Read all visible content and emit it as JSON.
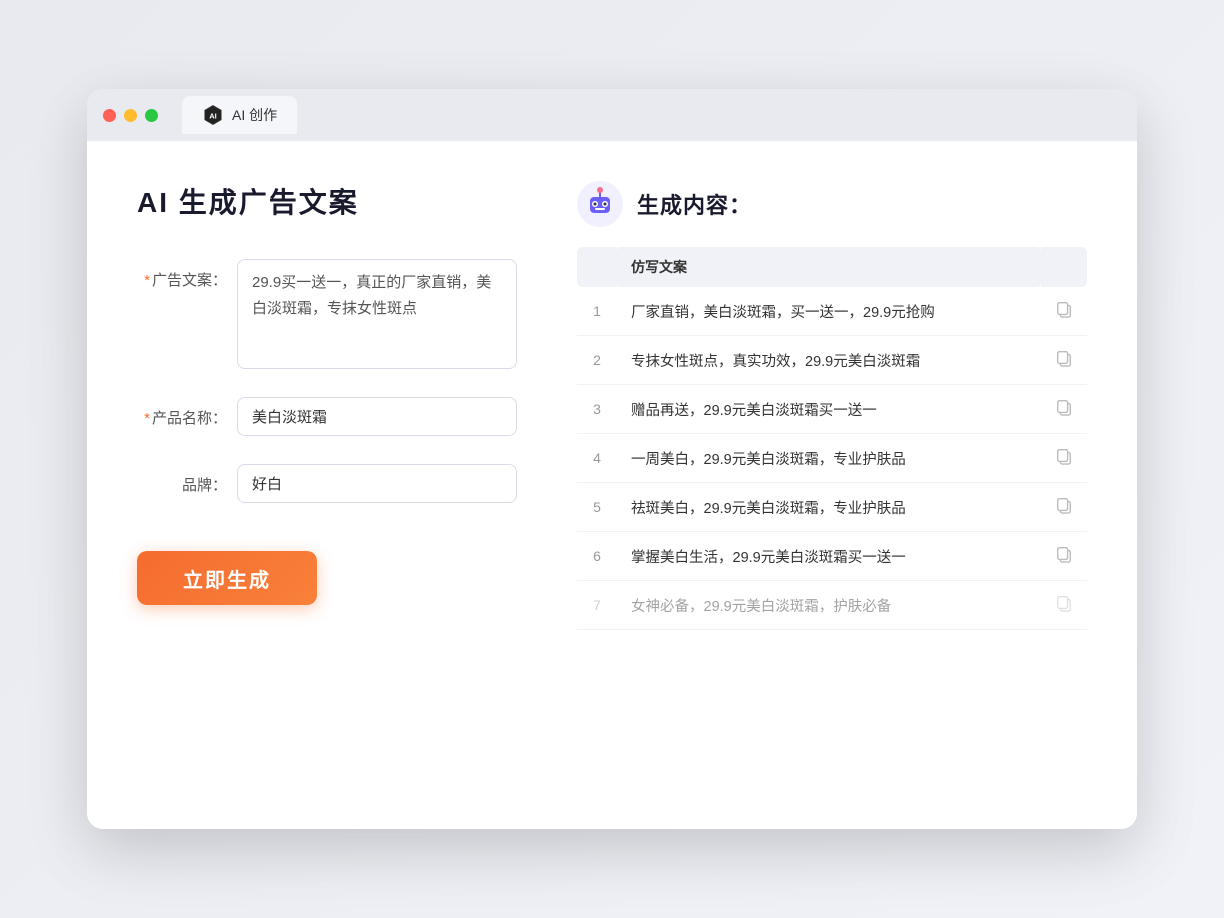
{
  "browser": {
    "tab_label": "AI 创作",
    "traffic_lights": [
      "red",
      "yellow",
      "green"
    ]
  },
  "left_panel": {
    "title": "AI 生成广告文案",
    "fields": [
      {
        "id": "ad_copy",
        "label": "广告文案：",
        "required": true,
        "type": "textarea",
        "value": "29.9买一送一，真正的厂家直销，美白淡斑霜，专抹女性斑点"
      },
      {
        "id": "product_name",
        "label": "产品名称：",
        "required": true,
        "type": "input",
        "value": "美白淡斑霜"
      },
      {
        "id": "brand",
        "label": "品牌：",
        "required": false,
        "type": "input",
        "value": "好白"
      }
    ],
    "submit_label": "立即生成"
  },
  "right_panel": {
    "title": "生成内容：",
    "col_header": "仿写文案",
    "results": [
      {
        "num": 1,
        "text": "厂家直销，美白淡斑霜，买一送一，29.9元抢购",
        "faded": false
      },
      {
        "num": 2,
        "text": "专抹女性斑点，真实功效，29.9元美白淡斑霜",
        "faded": false
      },
      {
        "num": 3,
        "text": "赠品再送，29.9元美白淡斑霜买一送一",
        "faded": false
      },
      {
        "num": 4,
        "text": "一周美白，29.9元美白淡斑霜，专业护肤品",
        "faded": false
      },
      {
        "num": 5,
        "text": "祛斑美白，29.9元美白淡斑霜，专业护肤品",
        "faded": false
      },
      {
        "num": 6,
        "text": "掌握美白生活，29.9元美白淡斑霜买一送一",
        "faded": false
      },
      {
        "num": 7,
        "text": "女神必备，29.9元美白淡斑霜，护肤必备",
        "faded": true
      }
    ]
  }
}
